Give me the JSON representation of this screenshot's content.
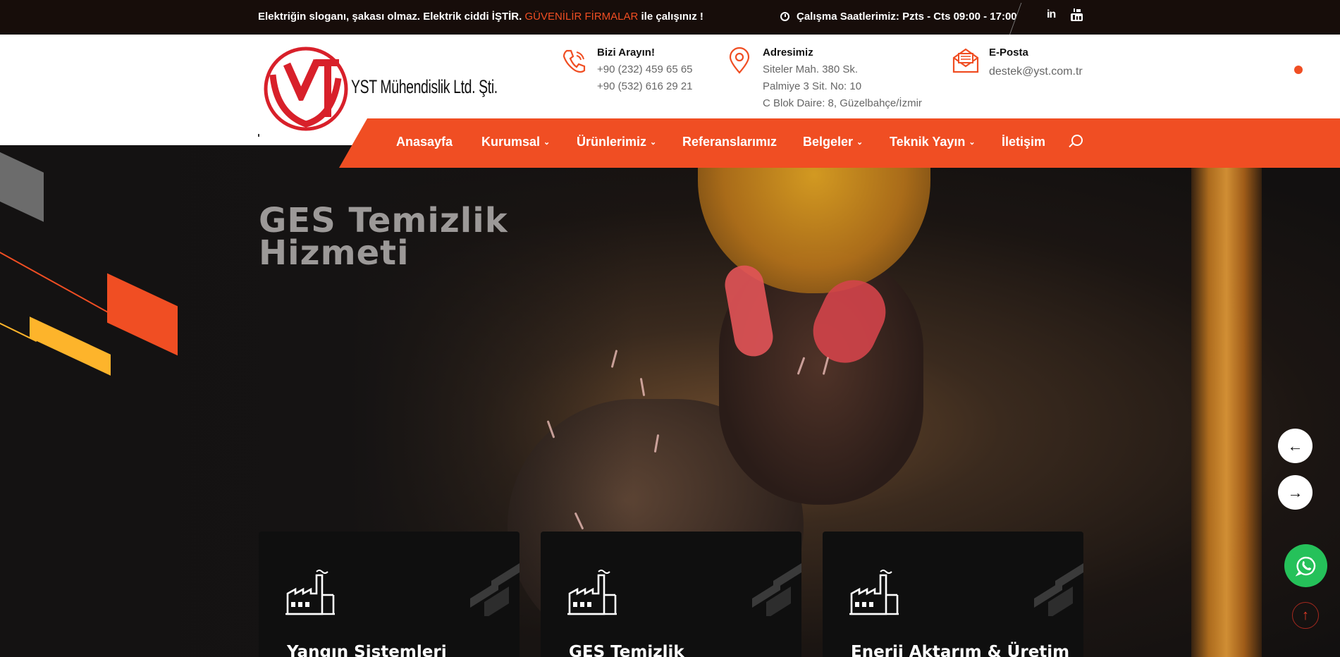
{
  "topbar": {
    "slogan_pre": "Elektriğin sloganı, şakası olmaz. Elektrik ciddi İŞTİR.",
    "slogan_accent": "GÜVENİLİR FİRMALAR",
    "slogan_post": "ile çalışınız !",
    "hours": "Çalışma Saatlerimiz: Pzts - Cts 09:00 - 17:00",
    "linkedin_label": "in",
    "social_icons": [
      "linkedin-icon",
      "youtube-icon"
    ]
  },
  "brand": {
    "name": "YST Mühendislik Ltd. Şti.",
    "logo_letters": "YST"
  },
  "contact": {
    "phone_title": "Bizi Arayın!",
    "phone1": "+90 (232) 459 65 65",
    "phone2": "+90 (532) 616 29 21",
    "address_title": "Adresimiz",
    "address1": "Siteler Mah. 380 Sk.",
    "address2": "Palmiye 3 Sit. No: 10",
    "address3": "C Blok Daire: 8, Güzelbahçe/İzmir",
    "email_title": "E-Posta",
    "email": "destek@yst.com.tr"
  },
  "nav": {
    "items": [
      {
        "label": "Anasayfa",
        "dropdown": false
      },
      {
        "label": "Kurumsal",
        "dropdown": true
      },
      {
        "label": "Ürünlerimiz",
        "dropdown": true
      },
      {
        "label": "Referanslarımız",
        "dropdown": false
      },
      {
        "label": "Belgeler",
        "dropdown": true
      },
      {
        "label": "Teknik Yayın",
        "dropdown": true
      },
      {
        "label": "İletişim",
        "dropdown": false
      }
    ],
    "chevron": "⌄"
  },
  "hero": {
    "title_line1": "GES Temizlik",
    "title_line2": "Hizmeti"
  },
  "slider": {
    "prev_symbol": "←",
    "next_symbol": "→"
  },
  "floating": {
    "to_top_symbol": "↑"
  },
  "cards": [
    {
      "title": "Yangın Sistemleri",
      "icon": "factory-icon"
    },
    {
      "title": "GES Temizlik",
      "icon": "factory-icon"
    },
    {
      "title": "Enerji Aktarım & Üretim",
      "icon": "factory-icon"
    }
  ],
  "colors": {
    "accent": "#f04e23",
    "yellow": "#fdb42b",
    "topbar_bg": "#170d0a",
    "whatsapp": "#25c15a"
  }
}
